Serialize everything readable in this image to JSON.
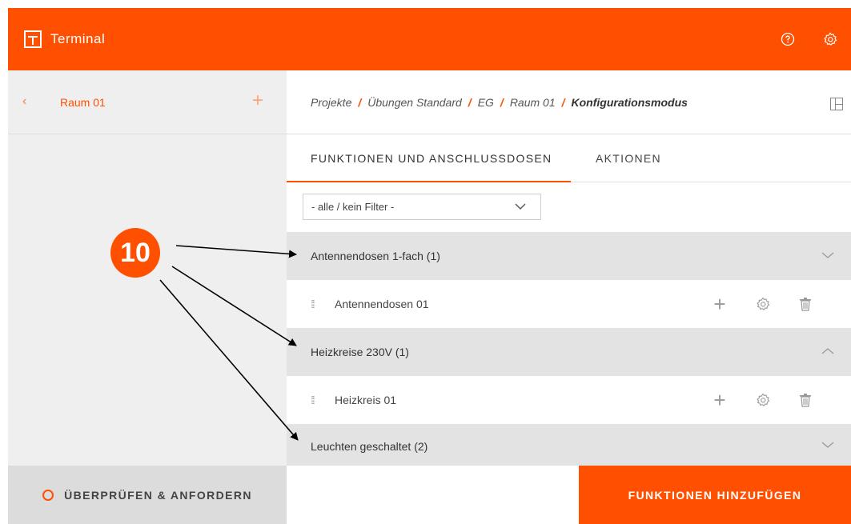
{
  "colors": {
    "accent": "#ff4f00",
    "sidebar_bg": "#efefef",
    "group_bg": "#e3e3e3"
  },
  "header": {
    "app_name": "Terminal",
    "help_icon": "help-circle-icon",
    "settings_icon": "gear-icon"
  },
  "sidebar": {
    "room_label": "Raum 01",
    "footer_label": "ÜBERPRÜFEN & ANFORDERN"
  },
  "breadcrumb": {
    "items": [
      "Projekte",
      "Übungen Standard",
      "EG",
      "Raum 01",
      "Konfigurationsmodus"
    ],
    "separator": "/"
  },
  "tabs": [
    "FUNKTIONEN UND ANSCHLUSSDOSEN",
    "AKTIONEN"
  ],
  "filter": {
    "value": "- alle / kein Filter -"
  },
  "groups": [
    {
      "label": "Antennendosen 1-fach (1)",
      "expanded": false,
      "items": [
        "Antennendosen 01"
      ]
    },
    {
      "label": "Heizkreise 230V (1)",
      "expanded": true,
      "items": [
        "Heizkreis 01"
      ]
    },
    {
      "label": "Leuchten geschaltet (2)",
      "expanded": false,
      "items": []
    }
  ],
  "footer": {
    "add_functions_label": "FUNKTIONEN HINZUFÜGEN"
  },
  "annotation": {
    "badge_number": "10"
  }
}
